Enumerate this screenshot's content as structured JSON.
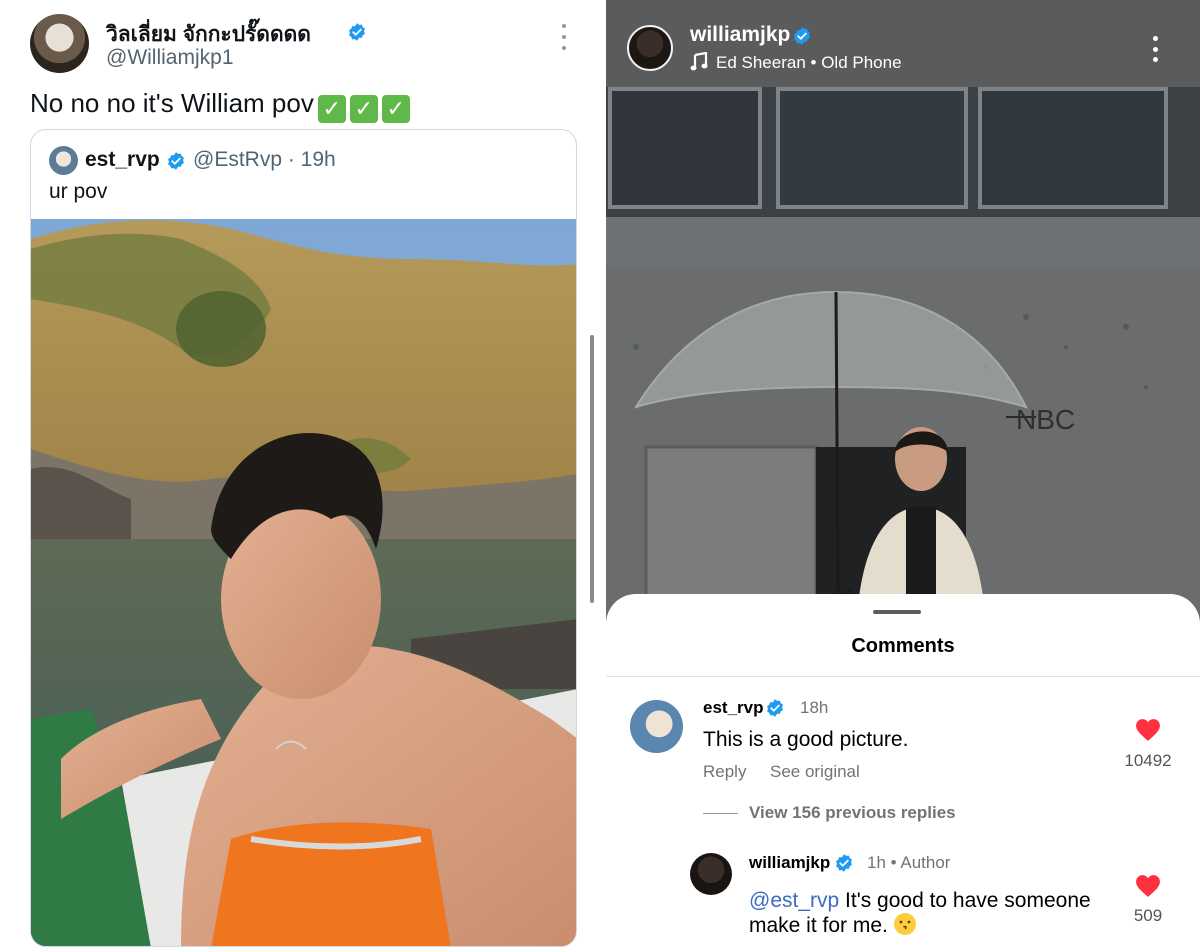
{
  "tweet": {
    "display_name": "วิลเลี่ยม จักกะปรั๊ดดดด",
    "handle": "@Williamjkp1",
    "text": "No no no it's William pov",
    "check_emojis": [
      "✓",
      "✓",
      "✓"
    ],
    "quote": {
      "display_name": "est_rvp",
      "handle_time": "@EstRvp · 19h",
      "text": "ur pov"
    }
  },
  "instagram": {
    "username": "williamjkp",
    "music": "Ed Sheeran • Old Phone",
    "comments_title": "Comments",
    "comment1": {
      "user": "est_rvp",
      "time": "18h",
      "text": "This is a good picture.",
      "reply_label": "Reply",
      "see_original_label": "See original",
      "likes": "10492"
    },
    "view_replies_label": "View 156 previous replies",
    "comment2": {
      "user": "williamjkp",
      "time": "1h • Author",
      "mention": "@est_rvp",
      "text": " It's good to have someone make it for me. ",
      "likes": "509"
    }
  },
  "colors": {
    "verified_blue": "#1d9bf0",
    "heart_red": "#ff3040",
    "mention_blue": "#3d6bc4",
    "check_green": "#5fb84a"
  }
}
